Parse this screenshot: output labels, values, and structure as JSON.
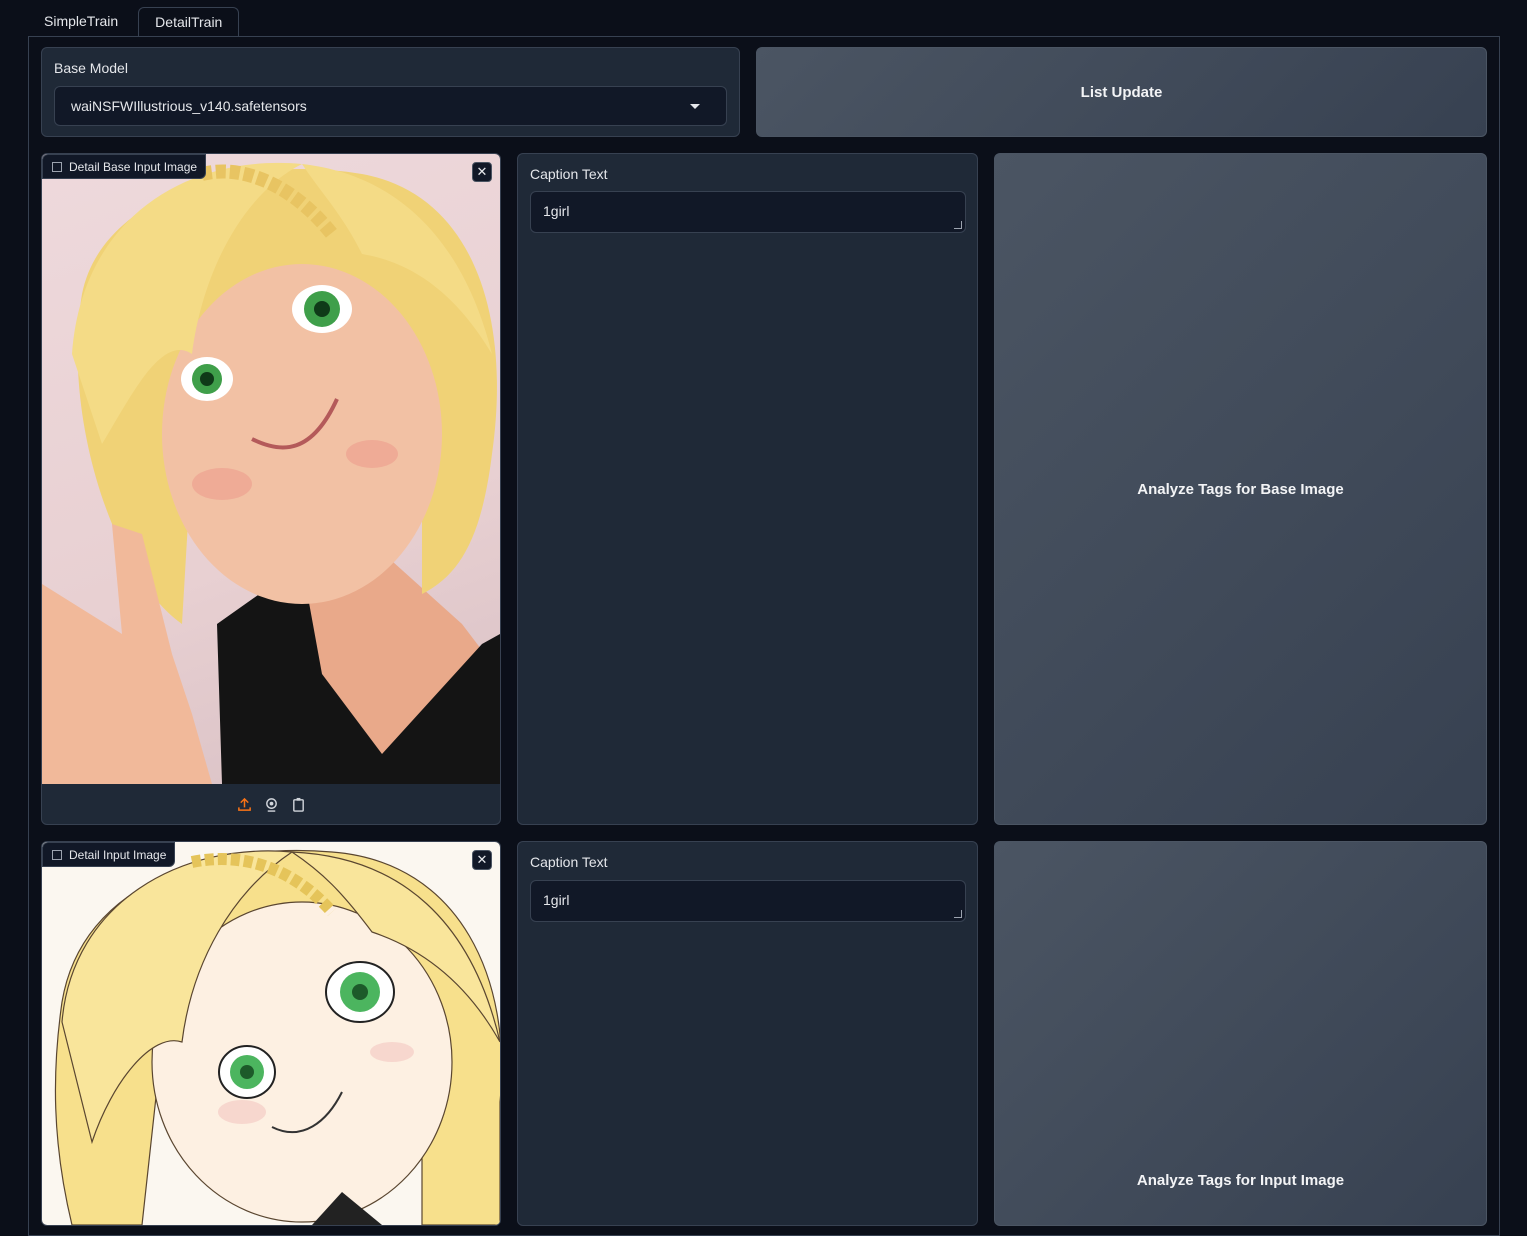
{
  "tabs": [
    {
      "label": "SimpleTrain",
      "active": false
    },
    {
      "label": "DetailTrain",
      "active": true
    }
  ],
  "base_model": {
    "label": "Base Model",
    "value": "waiNSFWIllustrious_v140.safetensors"
  },
  "list_update_label": "List Update",
  "base_image": {
    "label": "Detail Base Input Image",
    "toolbar_icons": [
      "upload-icon",
      "webcam-icon",
      "clipboard-icon"
    ]
  },
  "base_caption": {
    "label": "Caption Text",
    "value": "1girl"
  },
  "analyze_base_label": "Analyze Tags for Base Image",
  "input_image": {
    "label": "Detail Input Image"
  },
  "input_caption": {
    "label": "Caption Text",
    "value": "1girl"
  },
  "analyze_input_label": "Analyze Tags for Input Image",
  "close_glyph": "✕",
  "colors": {
    "background": "#0b0f19",
    "panel": "#1f2937",
    "border": "#374151",
    "accent_upload": "#f97316"
  }
}
